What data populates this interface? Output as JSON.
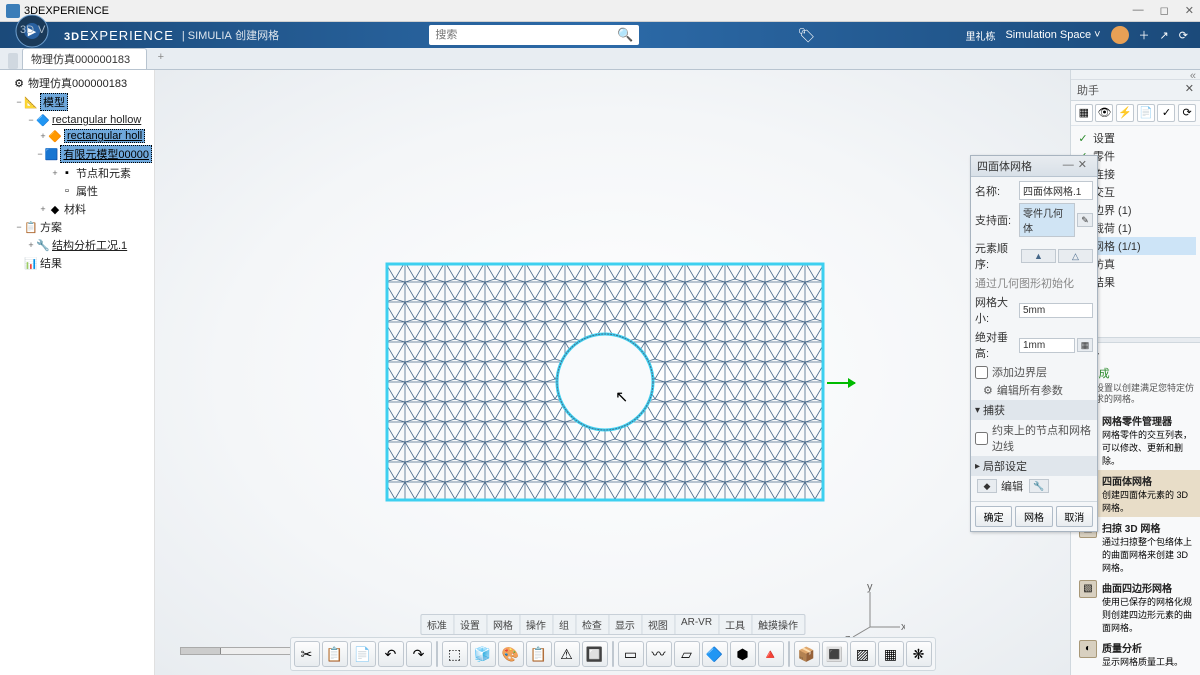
{
  "title": "3DEXPERIENCE",
  "brand": {
    "main": "3DEXPERIENCE",
    "sub": "| SIMULIA",
    "context": "创建网格"
  },
  "search": {
    "placeholder": "搜索"
  },
  "user": {
    "name": "里礼栋",
    "space": "Simulation Space"
  },
  "tab": {
    "name": "物理仿真000000183"
  },
  "tree": [
    {
      "ind": 0,
      "exp": "",
      "icon": "⚙",
      "label": "物理仿真000000183"
    },
    {
      "ind": 1,
      "exp": "−",
      "icon": "📐",
      "label": "模型",
      "sel": true
    },
    {
      "ind": 2,
      "exp": "−",
      "icon": "🔷",
      "label": "rectangular hollow",
      "ul": true
    },
    {
      "ind": 3,
      "exp": "+",
      "icon": "🔶",
      "label": "rectangular holl",
      "sel": true,
      "ul": true
    },
    {
      "ind": 3,
      "exp": "−",
      "icon": "🟦",
      "label": "有限元模型00000",
      "sel": true,
      "ul": true
    },
    {
      "ind": 4,
      "exp": "+",
      "icon": "▪",
      "label": "节点和元素"
    },
    {
      "ind": 4,
      "exp": "",
      "icon": "▫",
      "label": "属性"
    },
    {
      "ind": 3,
      "exp": "+",
      "icon": "◆",
      "label": "材料"
    },
    {
      "ind": 1,
      "exp": "−",
      "icon": "📋",
      "label": "方案"
    },
    {
      "ind": 2,
      "exp": "+",
      "icon": "🔧",
      "label": "结构分析工况.1",
      "ul": true
    },
    {
      "ind": 1,
      "exp": "",
      "icon": "📊",
      "label": "结果"
    }
  ],
  "panel": {
    "title": "四面体网格",
    "name_lbl": "名称:",
    "name_val": "四面体网格.1",
    "support_lbl": "支持面:",
    "support_val": "零件几何体",
    "order_lbl": "元素顺序:",
    "geom_init": "通过几何图形初始化",
    "size_lbl": "网格大小:",
    "size_val": "5mm",
    "sag_lbl": "绝对垂高:",
    "sag_val": "1mm",
    "add_layer": "添加边界层",
    "edit_params": "编辑所有参数",
    "capture": "捕获",
    "capture_opt": "约束上的节点和网格边线",
    "local": "局部设定",
    "edit": "编辑",
    "ok": "确定",
    "mesh": "网格",
    "cancel": "取消"
  },
  "assist": {
    "tab": "助手",
    "checks": [
      {
        "g": "ok",
        "t": "设置"
      },
      {
        "g": "ok",
        "t": "零件"
      },
      {
        "g": "warn",
        "t": "连接"
      },
      {
        "g": "warn",
        "t": "交互"
      },
      {
        "g": "err",
        "t": "边界 (1)"
      },
      {
        "g": "err",
        "t": "载荷 (1)"
      },
      {
        "g": "ok",
        "t": "网格 (1/1)",
        "active": true
      },
      {
        "g": "no",
        "t": "仿真"
      },
      {
        "g": "err",
        "t": "结果"
      }
    ],
    "cmd_h": "命令",
    "done": "✓ 完成",
    "desc": "定义设置以创建满足您特定仿真需求的网格。",
    "items": [
      {
        "t": "网格零件管理器",
        "d": "网格零件的交互列表，可以修改、更新和删除。"
      },
      {
        "t": "四面体网格",
        "d": "创建四面体元素的 3D 网格。",
        "hl": true
      },
      {
        "t": "扫掠 3D 网格",
        "d": "通过扫掠整个包络体上的曲面网格来创建 3D 网格。"
      },
      {
        "t": "曲面四边形网格",
        "d": "使用已保存的网格化规则创建四边形元素的曲面网格。"
      },
      {
        "t": "质量分析",
        "d": "显示网格质量工具。"
      }
    ]
  },
  "bottom_tabs": [
    "标准",
    "设置",
    "网格",
    "操作",
    "组",
    "检查",
    "显示",
    "视图",
    "AR-VR",
    "工具",
    "触摸操作"
  ],
  "triad": {
    "x": "x",
    "y": "y",
    "z": "z"
  }
}
